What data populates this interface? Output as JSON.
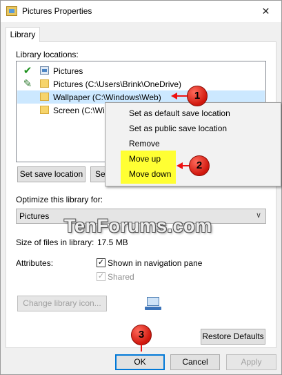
{
  "window": {
    "title": "Pictures Properties",
    "close_glyph": "✕"
  },
  "tabs": [
    {
      "label": "Library"
    }
  ],
  "library_locations": {
    "label": "Library locations:",
    "items": [
      {
        "status": "check",
        "icon": "pictures-library-icon",
        "text": "Pictures"
      },
      {
        "status": "sync",
        "icon": "folder-icon",
        "text": "Pictures (C:\\Users\\Brink\\OneDrive)"
      },
      {
        "status": "",
        "icon": "folder-icon",
        "text": "Wallpaper (C:\\Windows\\Web)",
        "selected": true
      },
      {
        "status": "",
        "icon": "folder-icon",
        "text": "Screen (C:\\Wi"
      }
    ]
  },
  "buttons": {
    "set_save_location": "Set save location",
    "set_public": "Se",
    "change_icon": "Change library icon...",
    "restore_defaults": "Restore Defaults",
    "ok": "OK",
    "cancel": "Cancel",
    "apply": "Apply"
  },
  "context_menu": {
    "items": [
      "Set as default save location",
      "Set as public save location",
      "Remove",
      "Move up",
      "Move down"
    ]
  },
  "optimize": {
    "label": "Optimize this library for:",
    "selected": "Pictures",
    "arrow": "∨"
  },
  "size": {
    "label": "Size of files in library:",
    "value": "17.5 MB"
  },
  "attributes": {
    "label": "Attributes:",
    "shown_in_nav": {
      "label": "Shown in navigation pane",
      "checked": true
    },
    "shared": {
      "label": "Shared",
      "checked": true,
      "disabled": true
    }
  },
  "markers": [
    "1",
    "2",
    "3"
  ],
  "watermark": "TenForums.com",
  "colors": {
    "accent": "#0078d7",
    "highlight": "#ffff33",
    "marker": "#e11e10",
    "selection": "#cce8ff"
  }
}
